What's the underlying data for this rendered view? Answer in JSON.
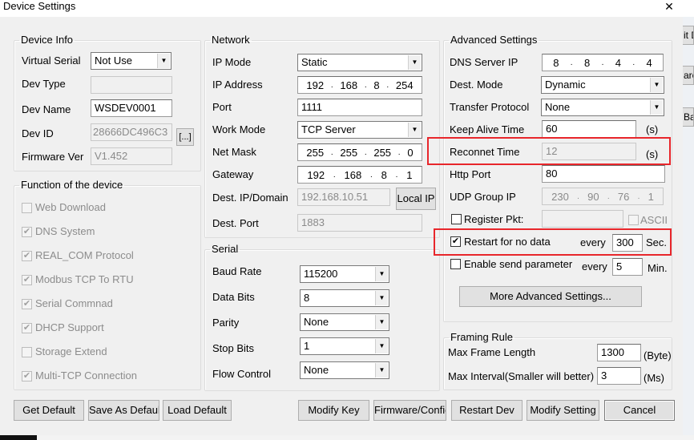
{
  "window": {
    "title": "Device Settings",
    "close_icon": "close-icon"
  },
  "background_buttons": [
    "it D",
    "arc",
    "Ba"
  ],
  "device_info": {
    "legend": "Device Info",
    "virtual_serial_label": "Virtual Serial",
    "virtual_serial_value": "Not Use",
    "dev_type_label": "Dev Type",
    "dev_type_value": "",
    "dev_name_label": "Dev Name",
    "dev_name_value": "WSDEV0001",
    "dev_id_label": "Dev ID",
    "dev_id_value": "28666DC496C3",
    "dev_id_button": "[...]",
    "firmware_label": "Firmware Ver",
    "firmware_value": "V1.452"
  },
  "functions": {
    "legend": "Function of the device",
    "items": [
      {
        "label": "Web Download",
        "checked": false
      },
      {
        "label": "DNS System",
        "checked": true
      },
      {
        "label": "REAL_COM Protocol",
        "checked": true
      },
      {
        "label": "Modbus TCP To RTU",
        "checked": true
      },
      {
        "label": "Serial Commnad",
        "checked": true
      },
      {
        "label": "DHCP Support",
        "checked": true
      },
      {
        "label": "Storage Extend",
        "checked": false
      },
      {
        "label": "Multi-TCP Connection",
        "checked": true
      }
    ]
  },
  "network": {
    "legend": "Network",
    "ip_mode_label": "IP Mode",
    "ip_mode_value": "Static",
    "ip_address_label": "IP Address",
    "ip_address": [
      "192",
      "168",
      "8",
      "254"
    ],
    "port_label": "Port",
    "port_value": "1111",
    "work_mode_label": "Work Mode",
    "work_mode_value": "TCP Server",
    "net_mask_label": "Net Mask",
    "net_mask": [
      "255",
      "255",
      "255",
      "0"
    ],
    "gateway_label": "Gateway",
    "gateway": [
      "192",
      "168",
      "8",
      "1"
    ],
    "dest_ip_label": "Dest. IP/Domain",
    "dest_ip_value": "192.168.10.51",
    "local_ip_button": "Local IP",
    "dest_port_label": "Dest. Port",
    "dest_port_value": "1883"
  },
  "serial": {
    "legend": "Serial",
    "baud_rate_label": "Baud Rate",
    "baud_rate_value": "115200",
    "data_bits_label": "Data Bits",
    "data_bits_value": "8",
    "parity_label": "Parity",
    "parity_value": "None",
    "stop_bits_label": "Stop Bits",
    "stop_bits_value": "1",
    "flow_control_label": "Flow Control",
    "flow_control_value": "None"
  },
  "advanced": {
    "legend": "Advanced Settings",
    "dns_server_label": "DNS Server IP",
    "dns_server": [
      "8",
      "8",
      "4",
      "4"
    ],
    "dest_mode_label": "Dest. Mode",
    "dest_mode_value": "Dynamic",
    "transfer_protocol_label": "Transfer Protocol",
    "transfer_protocol_value": "None",
    "keep_alive_label": "Keep Alive Time",
    "keep_alive_value": "60",
    "keep_alive_unit": "(s)",
    "reconnect_label": "Reconnet Time",
    "reconnect_value": "12",
    "reconnect_unit": "(s)",
    "http_port_label": "Http Port",
    "http_port_value": "80",
    "udp_group_label": "UDP Group IP",
    "udp_group": [
      "230",
      "90",
      "76",
      "1"
    ],
    "register_pkt_label": "Register Pkt:",
    "register_pkt_checked": false,
    "register_pkt_value": "",
    "ascii_label": "ASCII",
    "ascii_checked": false,
    "restart_label": "Restart for no data",
    "restart_checked": true,
    "restart_every": "every",
    "restart_value": "300",
    "restart_unit": "Sec.",
    "send_param_label": "Enable send parameter",
    "send_param_checked": false,
    "send_param_every": "every",
    "send_param_value": "5",
    "send_param_unit": "Min.",
    "more_button": "More Advanced Settings..."
  },
  "framing": {
    "legend": "Framing Rule",
    "max_frame_label": "Max Frame Length",
    "max_frame_value": "1300",
    "max_frame_unit": "(Byte)",
    "max_interval_label": "Max Interval(Smaller will better)",
    "max_interval_value": "3",
    "max_interval_unit": "(Ms)"
  },
  "buttons": {
    "get_default": "Get Default",
    "save_default": "Save As Default",
    "load_default": "Load Default",
    "modify_key": "Modify Key",
    "firmware_config": "Firmware/Config",
    "restart_dev": "Restart Dev",
    "modify_setting": "Modify Setting",
    "cancel": "Cancel"
  },
  "highlight_color": "#e8262b"
}
